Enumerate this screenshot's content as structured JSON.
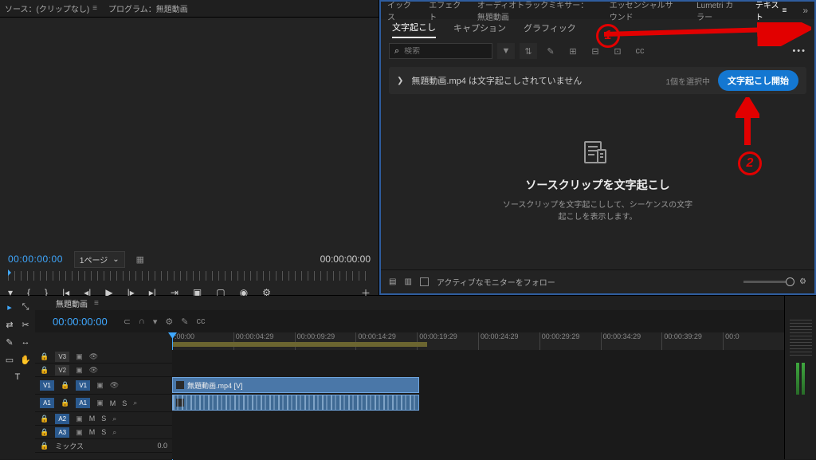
{
  "source": {
    "tab1": "ソース：(クリップなし)",
    "tab2": "プログラム：無題動画",
    "timecode_in": "00:00:00:00",
    "page_label": "1ページ",
    "timecode_out": "00:00:00:00"
  },
  "text_panel": {
    "top_tabs": [
      "イックス",
      "エフェクト",
      "オーディオトラックミキサー：無題動画",
      "エッセンシャルサウンド",
      "Lumetri カラー",
      "テキスト"
    ],
    "project": "無題動画",
    "subtabs": [
      "文字起こし",
      "キャプション",
      "グラフィック"
    ],
    "search_placeholder": "検索",
    "clip_line": "無題動画.mp4 は文字起こしされていません",
    "selected": "1個を選択中",
    "start_btn": "文字起こし開始",
    "center_title": "ソースクリップを文字起こし",
    "center_desc1": "ソースクリップを文字起こしして、シーケンスの文字",
    "center_desc2": "起こしを表示します。",
    "follow": "アクティブなモニターをフォロー"
  },
  "timeline": {
    "seq_name": "無題動画",
    "timecode": "00:00:00:00",
    "ruler": [
      ":00:00",
      "00:00:04:29",
      "00:00:09:29",
      "00:00:14:29",
      "00:00:19:29",
      "00:00:24:29",
      "00:00:29:29",
      "00:00:34:29",
      "00:00:39:29",
      "00:0"
    ],
    "tracks": {
      "v3": "V3",
      "v2": "V2",
      "v1": "V1",
      "a1": "A1",
      "a2": "A2",
      "a3": "A3",
      "mix": "ミックス"
    },
    "clip_label": "無題動画.mp4 [V]"
  },
  "annotations": {
    "n1": "1",
    "n2": "2"
  }
}
